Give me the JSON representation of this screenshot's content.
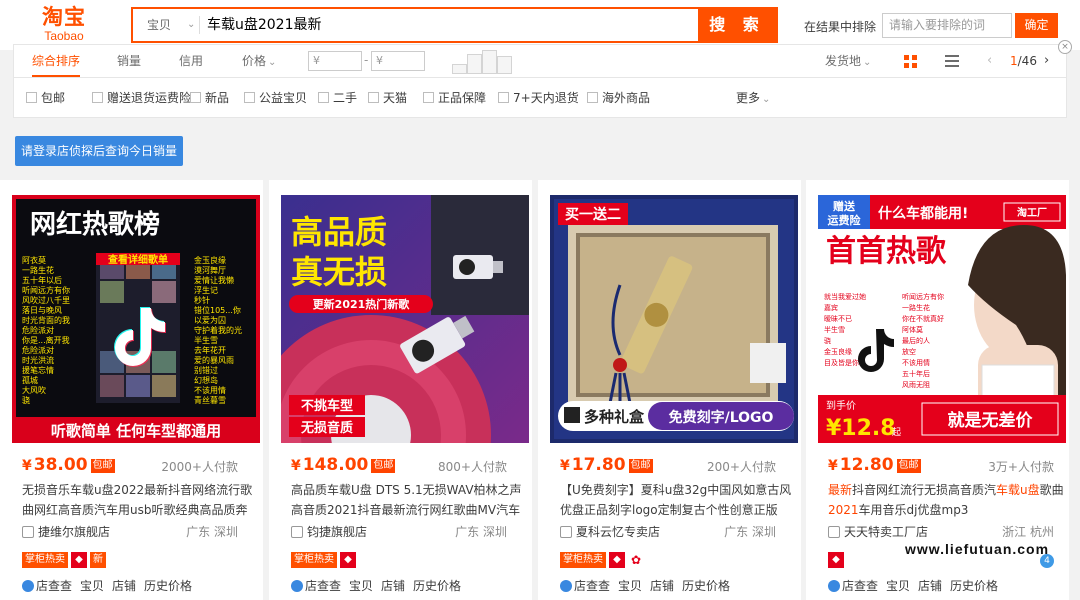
{
  "header": {
    "logo_cn": "淘宝",
    "logo_en": "Taobao",
    "search_type": "宝贝",
    "search_query": "车载u盘2021最新",
    "search_button": "搜 索",
    "exclude_label": "在结果中排除",
    "exclude_placeholder": "请输入要排除的词",
    "exclude_button": "确定"
  },
  "sortbar": {
    "items": [
      "综合排序",
      "销量",
      "信用",
      "价格"
    ],
    "price_from": "¥",
    "price_to": "¥",
    "ship_from": "发货地",
    "page_current": "1",
    "page_total": "/46"
  },
  "filters": {
    "items": [
      "包邮",
      "赠送退货运费险",
      "新品",
      "公益宝贝",
      "二手",
      "天猫",
      "正品保障",
      "7+天内退货",
      "海外商品"
    ],
    "more": "更多"
  },
  "login_button": "请登录店侦探后查询今日销量",
  "products": [
    {
      "price": "38.00",
      "baoyou": "包邮",
      "paid": "2000+人付款",
      "title": "无损音乐车载u盘2022最新抖音网络流行歌曲网红高音质汽车用usb听歌经典高品质奔",
      "shop": "捷维尔旗舰店",
      "location": "广东 深圳",
      "badge": "掌柜热卖",
      "image_banner_top": "网红热歌榜",
      "image_banner_mid": "查看详细歌单",
      "image_songs_left": [
        "阿衣莫",
        "一路生花",
        "五十年以后",
        "听闻远方有你",
        "风吹过八千里",
        "落日与晚风",
        "时光背面的我",
        "危险派对",
        "你是...离开我",
        "危险派对",
        "时光洪流",
        "援笔忘情",
        "孤城",
        "大风吹",
        "骁"
      ],
      "image_songs_right": [
        "金玉良缘",
        "漠河舞厅",
        "爱情让我懒",
        "浮生记",
        "秒针",
        "错位105...你",
        "以爱为囚",
        "守护着我的光",
        "半生雪",
        "去年花开",
        "爱的暴风雨",
        "别错过",
        "幻想岛",
        "不该用情",
        "青丝暮雪"
      ],
      "image_banner_bottom": "听歌简单 任何车型都通用"
    },
    {
      "price": "148.00",
      "baoyou": "包邮",
      "paid": "800+人付款",
      "title": "高品质车载U盘 DTS 5.1无损WAV柏林之声高音质2021抖音最新流行网红歌曲MV汽车",
      "shop": "钧捷旗舰店",
      "location": "广东 深圳",
      "badge": "掌柜热卖",
      "image_line1": "高品质",
      "image_line2": "真无损",
      "image_tag": "更新2021热门新歌",
      "image_sticker1": "不挑车型",
      "image_sticker2": "无损音质"
    },
    {
      "price": "17.80",
      "baoyou": "包邮",
      "paid": "200+人付款",
      "title": "【U免费刻字】夏科u盘32g中国风如意古风优盘正品刻字logo定制复古个性创意正版",
      "shop": "夏科云忆专卖店",
      "location": "广东 深圳",
      "badge": "掌柜热卖",
      "image_tag": "买一送二",
      "image_gift": "多种礼盒",
      "image_engrave": "免费刻字/LOGO"
    },
    {
      "price": "12.80",
      "baoyou": "包邮",
      "paid": "3万+人付款",
      "title_hl1": "最新",
      "title_mid1": "抖音网红流行无损高音质汽",
      "title_hl2": "车载u盘",
      "title_mid2": "歌曲",
      "title_hl3": "2021",
      "title_end": "车用音乐dj优盘mp3",
      "shop": "天天特卖工厂店",
      "location": "浙江 杭州",
      "image_gift1": "赠送",
      "image_gift2": "运费险",
      "image_slogan": "什么车都能用!",
      "image_brand": "淘工厂",
      "image_head": "首首热歌",
      "image_songs_left": [
        "就当我爱过她",
        "嘉宾",
        "暧昧不已",
        "半生雪",
        "骁",
        "金玉良缘",
        "目及皆是你"
      ],
      "image_songs_right": [
        "听闻远方有你",
        "一路生花",
        "你在不就真好",
        "阿体莫",
        "最后的人",
        "放空",
        "不该用情",
        "五十年后",
        "风雨无阻"
      ],
      "image_price_label": "到手价",
      "image_price": "¥12.8",
      "image_price_suffix": "起",
      "image_bottom": "就是无差价"
    }
  ],
  "links": [
    "店查查",
    "宝贝",
    "店铺",
    "历史价格"
  ],
  "watermark": "www.liefutuan.com"
}
